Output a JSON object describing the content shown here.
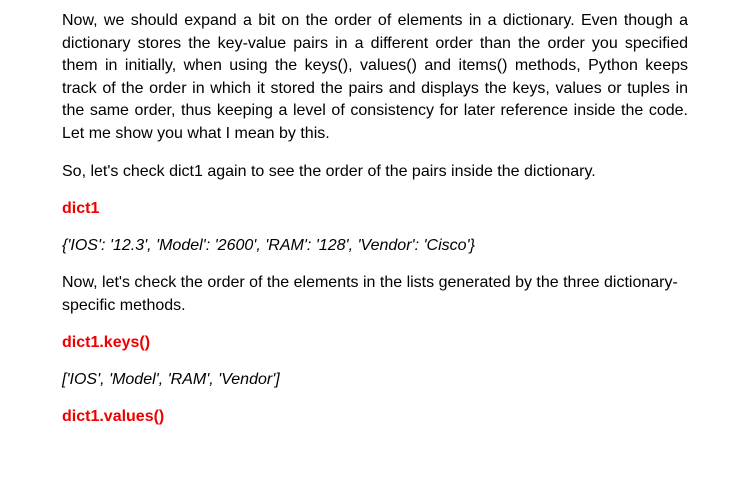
{
  "paragraphs": {
    "intro": "Now, we should expand a bit on the order of elements in a dictionary. Even though a dictionary stores the key-value pairs in a different order than the order you specified them in initially, when using the keys(), values() and items() methods, Python keeps track of the order in which it stored the pairs and displays the keys, values or tuples in the same order, thus keeping a level of consistency for later reference inside the code. Let me show you what I mean by this.",
    "check_again": "So, let's check dict1 again to see the order of the pairs inside the dictionary.",
    "check_lists": "Now, let's check the order of the elements in the lists generated by the three dictionary-specific methods."
  },
  "code": {
    "dict1": "dict1",
    "keys": "dict1.keys()",
    "values": "dict1.values()"
  },
  "output": {
    "dict1": "{'IOS': '12.3', 'Model': '2600', 'RAM': '128', 'Vendor': 'Cisco'}",
    "keys": "['IOS', 'Model', 'RAM', 'Vendor']"
  },
  "colors": {
    "code_text": "#ee0000",
    "body_text": "#000000"
  }
}
